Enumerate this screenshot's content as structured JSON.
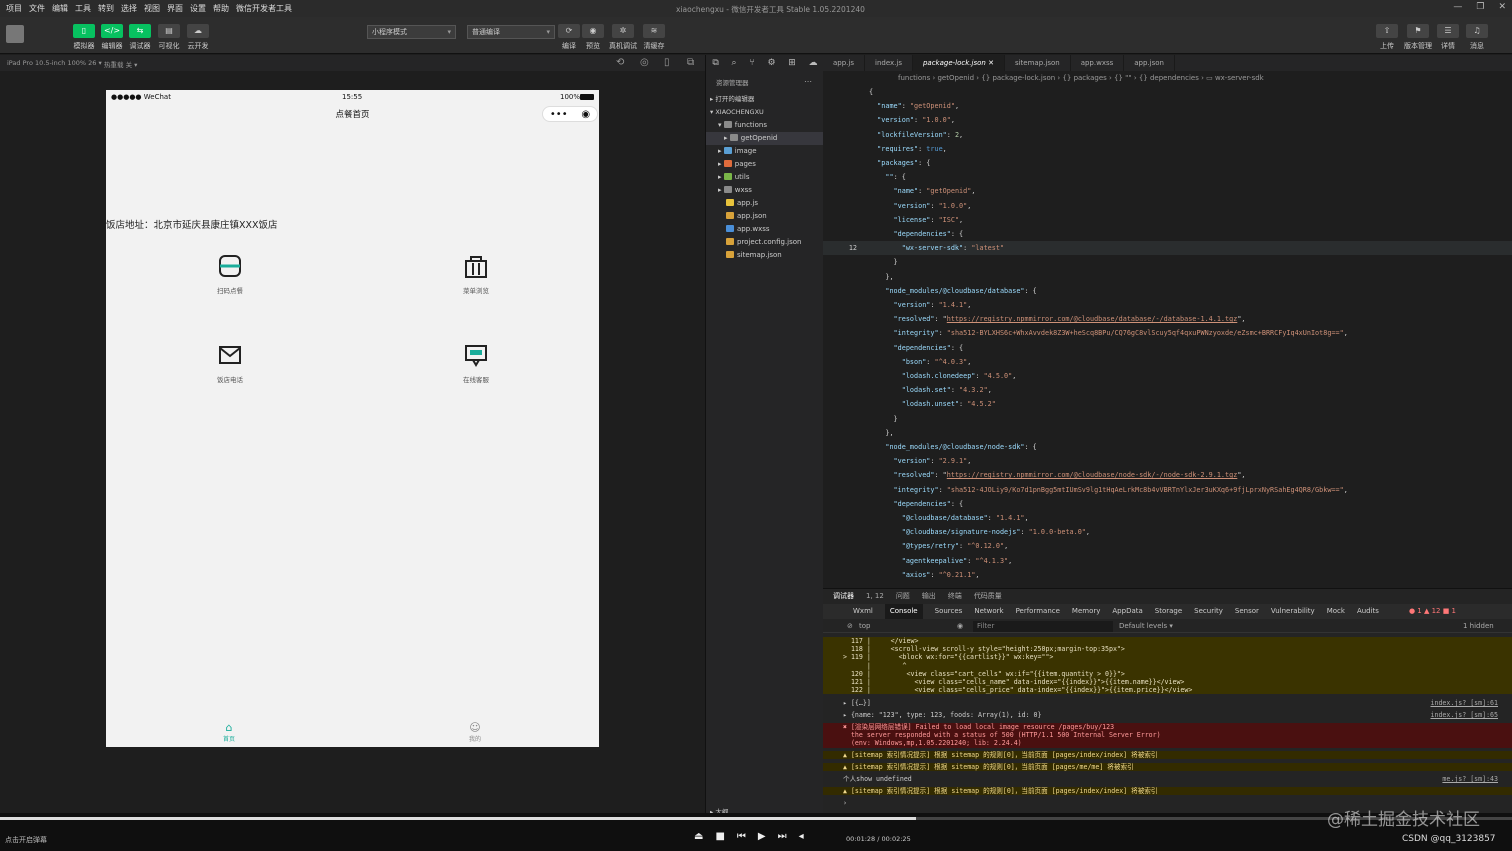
{
  "menubar": {
    "items": [
      "项目",
      "文件",
      "编辑",
      "工具",
      "转到",
      "选择",
      "视图",
      "界面",
      "设置",
      "帮助",
      "微信开发者工具"
    ],
    "title": "xiaochengxu - 微信开发者工具 Stable 1.05.2201240"
  },
  "toolbar": {
    "buttons": [
      "模拟器",
      "编辑器",
      "调试器",
      "可视化",
      "云开发"
    ],
    "mode": "小程序模式",
    "compile": "普通编译",
    "actions": [
      "编译",
      "预览",
      "真机调试",
      "清缓存"
    ],
    "right": [
      "上传",
      "版本管理",
      "详情",
      "消息"
    ]
  },
  "device": {
    "label": "iPad Pro 10.5-inch 100% 26 ▾",
    "hotreload": "热重载 关 ▾"
  },
  "phone": {
    "carrier": "●●●●● WeChat",
    "time": "15:55",
    "battery": "100%",
    "nav_title": "点餐首页",
    "address": "饭店地址：北京市延庆县康庄镇XXX饭店",
    "items": [
      {
        "label": "扫码点餐",
        "icon": "scan-icon"
      },
      {
        "label": "菜单浏览",
        "icon": "bag-icon"
      },
      {
        "label": "饭店电话",
        "icon": "mail-icon"
      },
      {
        "label": "在线客服",
        "icon": "chat-icon"
      }
    ],
    "tabs": [
      {
        "label": "首页",
        "icon": "home-icon"
      },
      {
        "label": "我的",
        "icon": "user-icon"
      }
    ]
  },
  "explorer": {
    "title": "资源管理器",
    "open_editors": "打开的编辑器",
    "project": "XIAOCHENGXU",
    "rows": [
      {
        "label": "functions",
        "type": "folder"
      },
      {
        "label": "getOpenid",
        "type": "folder"
      },
      {
        "label": "image",
        "type": "folder"
      },
      {
        "label": "pages",
        "type": "folder"
      },
      {
        "label": "utils",
        "type": "folder"
      },
      {
        "label": "wxss",
        "type": "folder"
      },
      {
        "label": "app.js",
        "type": "js"
      },
      {
        "label": "app.json",
        "type": "json"
      },
      {
        "label": "app.wxss",
        "type": "wxss"
      },
      {
        "label": "project.config.json",
        "type": "json"
      },
      {
        "label": "sitemap.json",
        "type": "json"
      }
    ],
    "outline": "大纲"
  },
  "editor": {
    "tabs": [
      "app.js",
      "index.js",
      "package-lock.json",
      "sitemap.json",
      "app.wxss",
      "app.json"
    ],
    "active_tab": "package-lock.json",
    "crumbs": "functions › getOpenid › {} package-lock.json › {} packages › {} \"\" › {} dependencies › ▭ wx-server-sdk",
    "code": [
      [
        {
          "t": "{",
          "c": "p"
        }
      ],
      [
        {
          "t": "  \"name\"",
          "c": "k"
        },
        {
          "t": ": ",
          "c": "p"
        },
        {
          "t": "\"getOpenid\"",
          "c": "s"
        },
        {
          "t": ",",
          "c": "p"
        }
      ],
      [
        {
          "t": "  \"version\"",
          "c": "k"
        },
        {
          "t": ": ",
          "c": "p"
        },
        {
          "t": "\"1.0.0\"",
          "c": "s"
        },
        {
          "t": ",",
          "c": "p"
        }
      ],
      [
        {
          "t": "  \"lockfileVersion\"",
          "c": "k"
        },
        {
          "t": ": ",
          "c": "p"
        },
        {
          "t": "2",
          "c": "n"
        },
        {
          "t": ",",
          "c": "p"
        }
      ],
      [
        {
          "t": "  \"requires\"",
          "c": "k"
        },
        {
          "t": ": ",
          "c": "p"
        },
        {
          "t": "true",
          "c": "b"
        },
        {
          "t": ",",
          "c": "p"
        }
      ],
      [
        {
          "t": "  \"packages\"",
          "c": "k"
        },
        {
          "t": ": {",
          "c": "p"
        }
      ],
      [
        {
          "t": "    \"\"",
          "c": "k"
        },
        {
          "t": ": {",
          "c": "p"
        }
      ],
      [
        {
          "t": "      \"name\"",
          "c": "k"
        },
        {
          "t": ": ",
          "c": "p"
        },
        {
          "t": "\"getOpenid\"",
          "c": "s"
        },
        {
          "t": ",",
          "c": "p"
        }
      ],
      [
        {
          "t": "      \"version\"",
          "c": "k"
        },
        {
          "t": ": ",
          "c": "p"
        },
        {
          "t": "\"1.0.0\"",
          "c": "s"
        },
        {
          "t": ",",
          "c": "p"
        }
      ],
      [
        {
          "t": "      \"license\"",
          "c": "k"
        },
        {
          "t": ": ",
          "c": "p"
        },
        {
          "t": "\"ISC\"",
          "c": "s"
        },
        {
          "t": ",",
          "c": "p"
        }
      ],
      [
        {
          "t": "      \"dependencies\"",
          "c": "k"
        },
        {
          "t": ": {",
          "c": "p"
        }
      ],
      [
        {
          "t": "        \"wx-server-sdk\"",
          "c": "k"
        },
        {
          "t": ": ",
          "c": "p"
        },
        {
          "t": "\"latest\"",
          "c": "s"
        }
      ],
      [
        {
          "t": "      }",
          "c": "p"
        }
      ],
      [
        {
          "t": "    },",
          "c": "p"
        }
      ],
      [
        {
          "t": "    \"node_modules/@cloudbase/database\"",
          "c": "k"
        },
        {
          "t": ": {",
          "c": "p"
        }
      ],
      [
        {
          "t": "      \"version\"",
          "c": "k"
        },
        {
          "t": ": ",
          "c": "p"
        },
        {
          "t": "\"1.4.1\"",
          "c": "s"
        },
        {
          "t": ",",
          "c": "p"
        }
      ],
      [
        {
          "t": "      \"resolved\"",
          "c": "k"
        },
        {
          "t": ": \"",
          "c": "p"
        },
        {
          "t": "https://registry.npmmirror.com/@cloudbase/database/-/database-1.4.1.tgz",
          "c": "u"
        },
        {
          "t": "\",",
          "c": "p"
        }
      ],
      [
        {
          "t": "      \"integrity\"",
          "c": "k"
        },
        {
          "t": ": ",
          "c": "p"
        },
        {
          "t": "\"sha512-BYLXHS6c+WhxAvvdek8Z3W+heScq8BPu/CQ76gC8vlScuy5qf4qxuPWNzyoxde/eZsmc+BRRCFyIq4xUnIot8g==\"",
          "c": "s"
        },
        {
          "t": ",",
          "c": "p"
        }
      ],
      [
        {
          "t": "      \"dependencies\"",
          "c": "k"
        },
        {
          "t": ": {",
          "c": "p"
        }
      ],
      [
        {
          "t": "        \"bson\"",
          "c": "k"
        },
        {
          "t": ": ",
          "c": "p"
        },
        {
          "t": "\"^4.0.3\"",
          "c": "s"
        },
        {
          "t": ",",
          "c": "p"
        }
      ],
      [
        {
          "t": "        \"lodash.clonedeep\"",
          "c": "k"
        },
        {
          "t": ": ",
          "c": "p"
        },
        {
          "t": "\"4.5.0\"",
          "c": "s"
        },
        {
          "t": ",",
          "c": "p"
        }
      ],
      [
        {
          "t": "        \"lodash.set\"",
          "c": "k"
        },
        {
          "t": ": ",
          "c": "p"
        },
        {
          "t": "\"4.3.2\"",
          "c": "s"
        },
        {
          "t": ",",
          "c": "p"
        }
      ],
      [
        {
          "t": "        \"lodash.unset\"",
          "c": "k"
        },
        {
          "t": ": ",
          "c": "p"
        },
        {
          "t": "\"4.5.2\"",
          "c": "s"
        }
      ],
      [
        {
          "t": "      }",
          "c": "p"
        }
      ],
      [
        {
          "t": "    },",
          "c": "p"
        }
      ],
      [
        {
          "t": "    \"node_modules/@cloudbase/node-sdk\"",
          "c": "k"
        },
        {
          "t": ": {",
          "c": "p"
        }
      ],
      [
        {
          "t": "      \"version\"",
          "c": "k"
        },
        {
          "t": ": ",
          "c": "p"
        },
        {
          "t": "\"2.9.1\"",
          "c": "s"
        },
        {
          "t": ",",
          "c": "p"
        }
      ],
      [
        {
          "t": "      \"resolved\"",
          "c": "k"
        },
        {
          "t": ": \"",
          "c": "p"
        },
        {
          "t": "https://registry.npmmirror.com/@cloudbase/node-sdk/-/node-sdk-2.9.1.tgz",
          "c": "u"
        },
        {
          "t": "\",",
          "c": "p"
        }
      ],
      [
        {
          "t": "      \"integrity\"",
          "c": "k"
        },
        {
          "t": ": ",
          "c": "p"
        },
        {
          "t": "\"sha512-4JOLiy9/Ko7d1pnBgg5mtIUmSv9lg1tHqAeLrkMc8b4vVBRTnYlxJer3uKXq6+9fjLprxNyRSahEg4QR8/Gbkw==\"",
          "c": "s"
        },
        {
          "t": ",",
          "c": "p"
        }
      ],
      [
        {
          "t": "      \"dependencies\"",
          "c": "k"
        },
        {
          "t": ": {",
          "c": "p"
        }
      ],
      [
        {
          "t": "        \"@cloudbase/database\"",
          "c": "k"
        },
        {
          "t": ": ",
          "c": "p"
        },
        {
          "t": "\"1.4.1\"",
          "c": "s"
        },
        {
          "t": ",",
          "c": "p"
        }
      ],
      [
        {
          "t": "        \"@cloudbase/signature-nodejs\"",
          "c": "k"
        },
        {
          "t": ": ",
          "c": "p"
        },
        {
          "t": "\"1.0.0-beta.0\"",
          "c": "s"
        },
        {
          "t": ",",
          "c": "p"
        }
      ],
      [
        {
          "t": "        \"@types/retry\"",
          "c": "k"
        },
        {
          "t": ": ",
          "c": "p"
        },
        {
          "t": "\"^0.12.0\"",
          "c": "s"
        },
        {
          "t": ",",
          "c": "p"
        }
      ],
      [
        {
          "t": "        \"agentkeepalive\"",
          "c": "k"
        },
        {
          "t": ": ",
          "c": "p"
        },
        {
          "t": "\"^4.1.3\"",
          "c": "s"
        },
        {
          "t": ",",
          "c": "p"
        }
      ],
      [
        {
          "t": "        \"axios\"",
          "c": "k"
        },
        {
          "t": ": ",
          "c": "p"
        },
        {
          "t": "\"^0.21.1\"",
          "c": "s"
        },
        {
          "t": ",",
          "c": "p"
        }
      ]
    ],
    "visible_line_number": "12"
  },
  "console": {
    "top_tabs": [
      "调试器",
      "1, 12",
      "问题",
      "输出",
      "终端",
      "代码质量"
    ],
    "tabs": [
      "Wxml",
      "Console",
      "Sources",
      "Network",
      "Performance",
      "Memory",
      "AppData",
      "Storage",
      "Security",
      "Sensor",
      "Vulnerability",
      "Mock",
      "Audits"
    ],
    "active": "Console",
    "context": "top",
    "filter_placeholder": "Filter",
    "levels": "Default levels ▾",
    "hidden": "1 hidden",
    "counts": "● 1 ▲ 12 ■ 1",
    "logs": [
      {
        "type": "code",
        "text": "  117 |     </view>\n  118 |     <scroll-view scroll-y style=\"height:250px;margin-top:35px\">\n> 119 |       <block wx:for=\"{{cartlist}}\" wx:key=\"\">\n      |        ^\n  120 |         <view class=\"cart_cells\" wx:if=\"{{item.quantity > 0}}\">\n  121 |           <view class=\"cells_name\" data-index=\"{{index}}\">{{item.name}}</view>\n  122 |           <view class=\"cells_price\" data-index=\"{{index}}\">{{item.price}}</view>"
      },
      {
        "type": "log",
        "text": "▸ [{…}]",
        "src": "index.js? [sm]:61"
      },
      {
        "type": "log",
        "text": "▸ {name: \"123\", type: 123, foods: Array(1), id: 0}",
        "src": "index.js? [sm]:65"
      },
      {
        "type": "err",
        "text": "✖ [渲染层网络层错误] Failed to load local image resource /pages/buy/123\n  the server responded with a status of 500 (HTTP/1.1 500 Internal Server Error)\n  (env: Windows,mp,1.05.2201240; lib: 2.24.4)"
      },
      {
        "type": "warn",
        "text": "▲ [sitemap 索引情况提示] 根据 sitemap 的规则[0]，当前页面 [pages/index/index] 将被索引"
      },
      {
        "type": "warn",
        "text": "▲ [sitemap 索引情况提示] 根据 sitemap 的规则[0]，当前页面 [pages/me/me] 将被索引"
      },
      {
        "type": "log",
        "text": "个人show undefined",
        "src": "me.js? [sm]:43"
      },
      {
        "type": "warn",
        "text": "▲ [sitemap 索引情况提示] 根据 sitemap 的规则[0]，当前页面 [pages/index/index] 将被索引"
      },
      {
        "type": "log",
        "text": "›"
      }
    ]
  },
  "player": {
    "hint": "点击开启弹幕",
    "time": "00:01:28 / 00:02:25"
  },
  "watermark": "@稀土掘金技术社区",
  "csdn": "CSDN @qq_3123857"
}
